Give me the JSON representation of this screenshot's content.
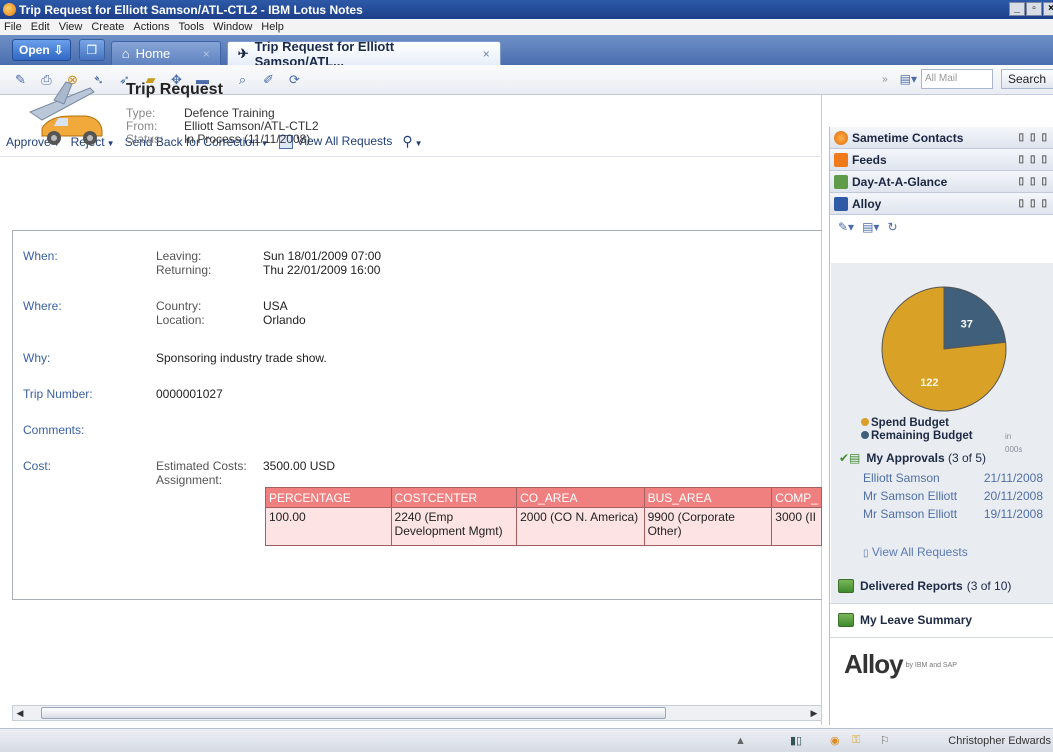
{
  "window": {
    "title": "Trip Request for Elliott Samson/ATL-CTL2 - IBM Lotus Notes"
  },
  "menu": [
    "File",
    "Edit",
    "View",
    "Create",
    "Actions",
    "Tools",
    "Window",
    "Help"
  ],
  "tabs": {
    "open_label": "Open",
    "home_label": "Home",
    "active_label": "Trip Request for Elliott Samson/ATL..."
  },
  "search": {
    "scope": "All Mail",
    "button": "Search"
  },
  "actions": {
    "approve": "Approve",
    "reject": "Reject",
    "send_back": "Send Back for Correction",
    "view_all": "View All Requests"
  },
  "request": {
    "title": "Trip Request",
    "type_label": "Type:",
    "type": "Defence Training",
    "from_label": "From:",
    "from": "Elliott Samson/ATL-CTL2",
    "status_label": "Status:",
    "status": "In Process (11/11/2008)"
  },
  "details": {
    "when_label": "When:",
    "leaving_label": "Leaving:",
    "leaving": "Sun 18/01/2009 07:00",
    "returning_label": "Returning:",
    "returning": "Thu 22/01/2009 16:00",
    "where_label": "Where:",
    "country_label": "Country:",
    "country": "USA",
    "location_label": "Location:",
    "location": "Orlando",
    "why_label": "Why:",
    "why": "Sponsoring industry trade show.",
    "trip_number_label": "Trip Number:",
    "trip_number": "0000001027",
    "comments_label": "Comments:",
    "cost_label": "Cost:",
    "estimated_label": "Estimated Costs:",
    "estimated": "3500.00 USD",
    "assignment_label": "Assignment:"
  },
  "assignment_table": {
    "headers": [
      "PERCENTAGE",
      "COSTCENTER",
      "CO_AREA",
      "BUS_AREA",
      "COMP_"
    ],
    "rows": [
      [
        "100.00",
        "2240 (Emp Development Mgmt)",
        "2000 (CO N. America)",
        "9900 (Corporate Other)",
        "3000 (II"
      ]
    ]
  },
  "sidebar": {
    "sametime": "Sametime Contacts",
    "feeds": "Feeds",
    "dayataglance": "Day-At-A-Glance",
    "alloy": "Alloy",
    "legend_spend": "Spend Budget",
    "legend_remaining": "Remaining Budget",
    "legend_unit": "in 000s",
    "approvals_title": "My Approvals",
    "approvals_count": "(3 of 5)",
    "approvals": [
      {
        "name": "Elliott Samson",
        "date": "21/11/2008"
      },
      {
        "name": "Mr Samson Elliott",
        "date": "20/11/2008"
      },
      {
        "name": "Mr Samson Elliott",
        "date": "19/11/2008"
      }
    ],
    "view_all": "View All Requests",
    "delivered_title": "Delivered Reports",
    "delivered_count": "(3 of 10)",
    "leave_title": "My Leave Summary",
    "logo": "Alloy",
    "logo_by": "by IBM and SAP"
  },
  "chart_data": {
    "type": "pie",
    "labels": [
      "Spend Budget",
      "Remaining Budget"
    ],
    "values": [
      122,
      37
    ],
    "colors": [
      "#d9a126",
      "#3f5f7a"
    ],
    "unit": "in 000s",
    "legend": "bottom"
  },
  "status": {
    "user": "Christopher Edwards"
  }
}
